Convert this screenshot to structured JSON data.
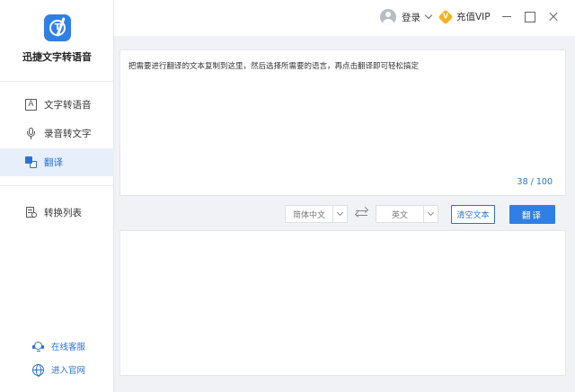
{
  "app": {
    "title": "迅捷文字转语音",
    "logo_text": "T"
  },
  "sidebar": {
    "items": [
      {
        "label": "文字转语音",
        "icon": "text-icon",
        "active": false
      },
      {
        "label": "录音转文字",
        "icon": "microphone-icon",
        "active": false
      },
      {
        "label": "翻译",
        "icon": "translate-icon",
        "active": true
      },
      {
        "label": "转换列表",
        "icon": "convert-list-icon",
        "active": false
      }
    ],
    "footer": [
      {
        "label": "在线客服",
        "icon": "customer-service-icon"
      },
      {
        "label": "进入官网",
        "icon": "globe-icon"
      }
    ]
  },
  "topbar": {
    "login_label": "登录",
    "vip_label": "充值VIP",
    "vip_icon_text": "V"
  },
  "translate": {
    "source_text": "把需要进行翻译的文本复制到这里，然后选择所需要的语言，再点击翻译即可轻松搞定",
    "counter": "38 / 100",
    "source_lang": "简体中文",
    "target_lang": "英文",
    "clear_label": "清空文本",
    "translate_label": "翻译",
    "result_text": ""
  },
  "colors": {
    "accent": "#2f7fe6",
    "link": "#2b72d6",
    "vip": "#f5b21f",
    "active_bg": "#e6effa"
  }
}
